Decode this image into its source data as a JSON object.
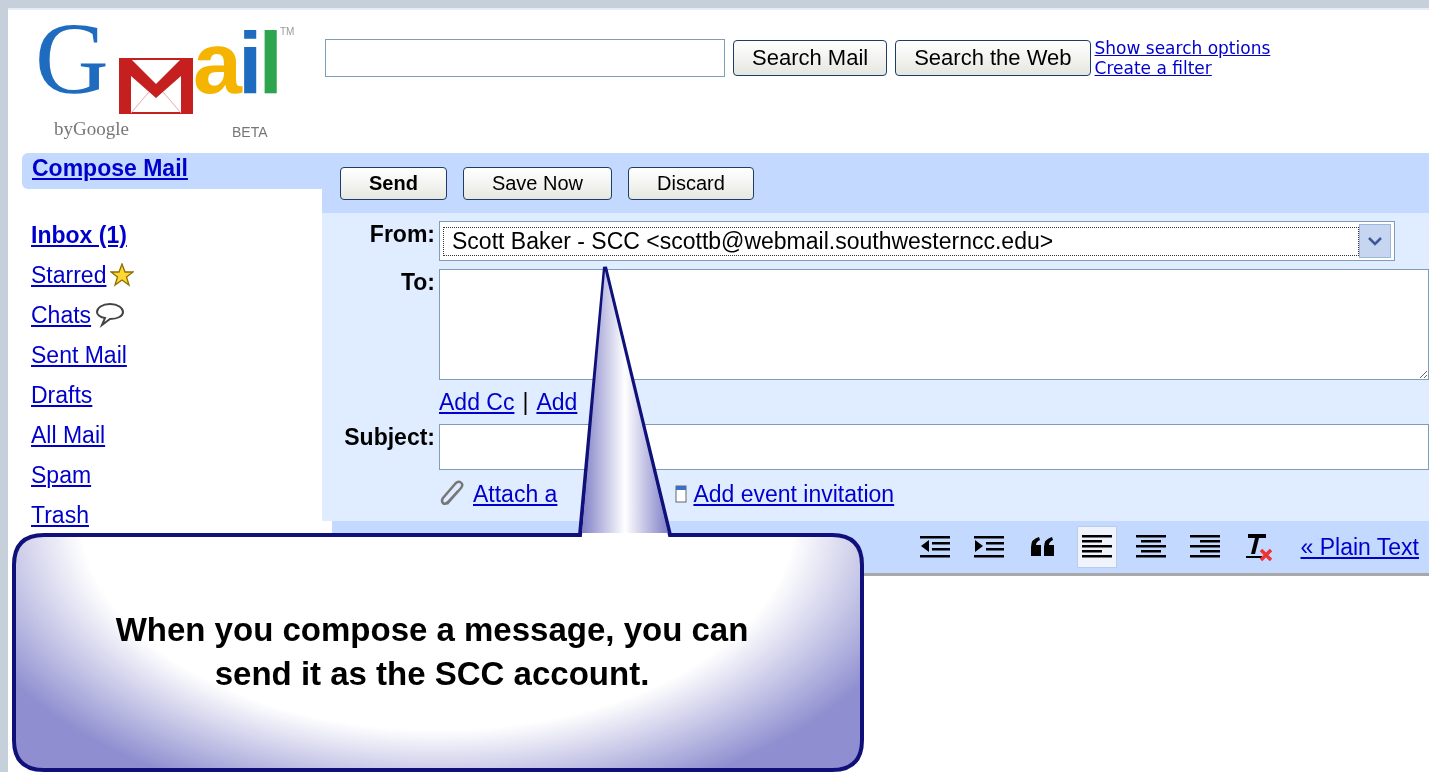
{
  "logo": {
    "first": "G",
    "rest": "ail",
    "tm": "TM",
    "byline": "byGoogle",
    "beta": "BETA"
  },
  "search": {
    "buttons": [
      "Search Mail",
      "Search the Web"
    ],
    "links": [
      "Show search options",
      "Create a filter"
    ]
  },
  "sidebar": {
    "compose": "Compose Mail",
    "items": [
      {
        "label": "Inbox (1)",
        "unread": true,
        "kind": "plain"
      },
      {
        "label": "Starred",
        "unread": false,
        "kind": "star"
      },
      {
        "label": "Chats",
        "unread": false,
        "kind": "chat"
      },
      {
        "label": "Sent Mail",
        "unread": false,
        "kind": "plain"
      },
      {
        "label": "Drafts",
        "unread": false,
        "kind": "plain"
      },
      {
        "label": "All Mail",
        "unread": false,
        "kind": "plain"
      },
      {
        "label": "Spam",
        "unread": false,
        "kind": "plain"
      },
      {
        "label": "Trash",
        "unread": false,
        "kind": "plain"
      }
    ]
  },
  "actions": [
    {
      "label": "Send",
      "primary": true
    },
    {
      "label": "Save Now",
      "primary": false
    },
    {
      "label": "Discard",
      "primary": false
    }
  ],
  "compose": {
    "from_label": "From:",
    "from_value": "Scott Baker - SCC <scottb@webmail.southwesterncc.edu>",
    "to_label": "To:",
    "cc_links": [
      "Add Cc",
      "Add"
    ],
    "cc_separator": "|",
    "subject_label": "Subject:",
    "attach_link": "Attach a",
    "event_link": "Add event invitation"
  },
  "format_toolbar": {
    "tools": [
      {
        "kind": "outdent",
        "selected": false
      },
      {
        "kind": "indent",
        "selected": false
      },
      {
        "kind": "quote",
        "selected": false
      },
      {
        "kind": "align-left",
        "selected": true
      },
      {
        "kind": "align-center",
        "selected": false
      },
      {
        "kind": "align-right",
        "selected": false
      },
      {
        "kind": "clear-format",
        "selected": false
      }
    ],
    "plain_text_link": "« Plain Text"
  },
  "callout": {
    "lines": [
      "When you compose a message, you can",
      "send it as the SCC account."
    ]
  }
}
